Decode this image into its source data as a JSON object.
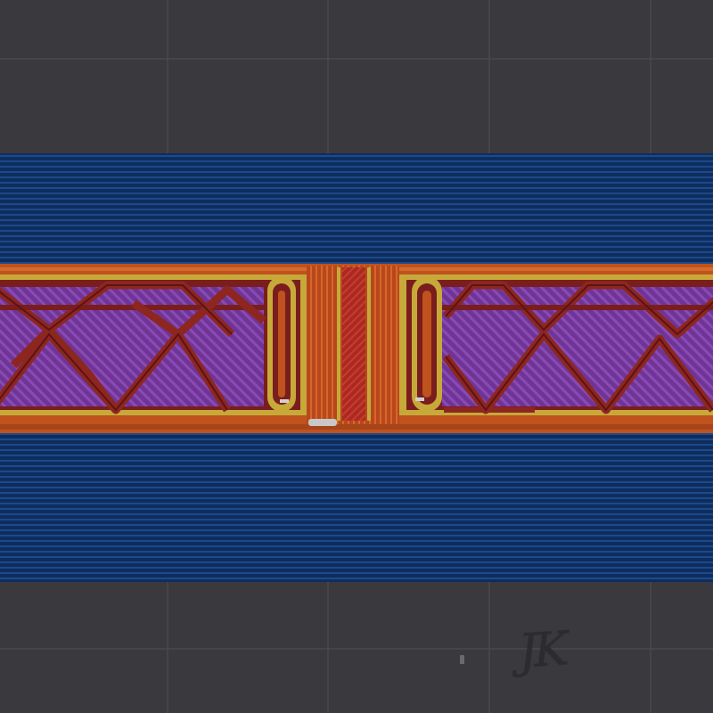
{
  "viewer": {
    "name": "gcode-layer-preview",
    "watermark_text": "JK",
    "colors": {
      "background": "#3a393d",
      "grid": "#4a494e",
      "solid_infill": "#0e2d5e",
      "solid_infill_line": "#1c4a8a",
      "sparse_infill": "#6f3596",
      "sparse_infill_line": "#8a4ab4",
      "internal_perimeter": "#7a1d1d",
      "external_perimeter": "#c7a93a",
      "overhang_perimeter": "#c0521e",
      "gap_fill": "#c8c8c8"
    },
    "icons": [
      "watermark-logo",
      "travel-marker-icon"
    ]
  }
}
